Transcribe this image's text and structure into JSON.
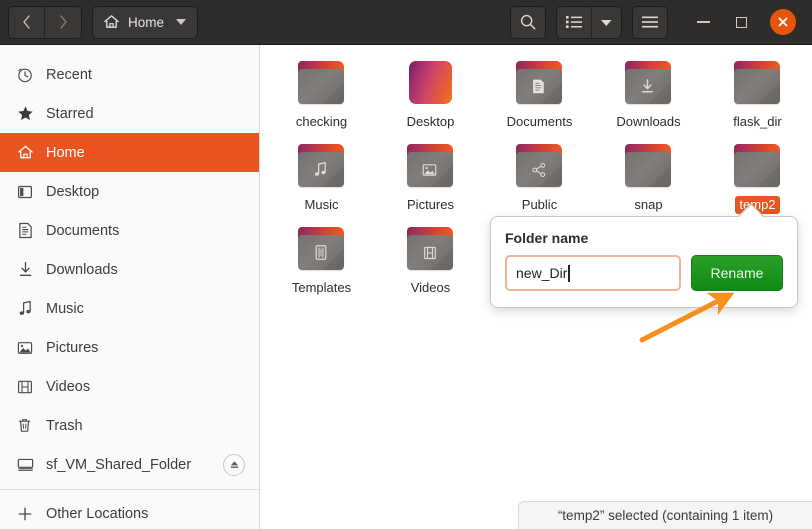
{
  "window": {
    "titlebar": {
      "back_label": "‹",
      "forward_label": "›",
      "path_label": "Home",
      "home_icon": "home-icon",
      "search_icon": "search-icon",
      "list_view_icon": "list-view-icon",
      "view_dropdown_icon": "chevron-down-icon",
      "menu_icon": "hamburger-menu-icon",
      "minimize_label": "–",
      "maximize_label": "□",
      "close_label": "✕"
    },
    "accent_color": "#e95420",
    "titlebar_color": "#2f2d2c"
  },
  "sidebar": {
    "items": [
      {
        "label": "Recent",
        "icon": "clock-icon",
        "active": false
      },
      {
        "label": "Starred",
        "icon": "star-icon",
        "active": false
      },
      {
        "label": "Home",
        "icon": "home-icon",
        "active": true
      },
      {
        "label": "Desktop",
        "icon": "desktop-icon",
        "active": false
      },
      {
        "label": "Documents",
        "icon": "document-icon",
        "active": false
      },
      {
        "label": "Downloads",
        "icon": "download-icon",
        "active": false
      },
      {
        "label": "Music",
        "icon": "music-note-icon",
        "active": false
      },
      {
        "label": "Pictures",
        "icon": "image-icon",
        "active": false
      },
      {
        "label": "Videos",
        "icon": "film-icon",
        "active": false
      },
      {
        "label": "Trash",
        "icon": "trash-icon",
        "active": false
      },
      {
        "label": "sf_VM_Shared_Folder",
        "icon": "drive-icon",
        "active": false,
        "eject": true
      }
    ],
    "other_locations": {
      "label": "Other Locations",
      "icon": "plus-icon"
    }
  },
  "files": [
    {
      "name": "checking",
      "type": "folder",
      "glyph": "",
      "selected": false
    },
    {
      "name": "Desktop",
      "type": "special",
      "glyph": "",
      "selected": false
    },
    {
      "name": "Documents",
      "type": "folder",
      "glyph": "document-icon",
      "selected": false
    },
    {
      "name": "Downloads",
      "type": "folder",
      "glyph": "download-icon",
      "selected": false
    },
    {
      "name": "flask_dir",
      "type": "folder",
      "glyph": "",
      "selected": false
    },
    {
      "name": "Music",
      "type": "folder",
      "glyph": "music-note-icon",
      "selected": false
    },
    {
      "name": "Pictures",
      "type": "folder",
      "glyph": "image-icon",
      "selected": false
    },
    {
      "name": "Public",
      "type": "folder",
      "glyph": "share-icon",
      "selected": false
    },
    {
      "name": "snap",
      "type": "folder",
      "glyph": "",
      "selected": false
    },
    {
      "name": "temp2",
      "type": "folder",
      "glyph": "",
      "selected": true
    },
    {
      "name": "Templates",
      "type": "folder",
      "glyph": "template-icon",
      "selected": false
    },
    {
      "name": "Videos",
      "type": "folder",
      "glyph": "film-icon",
      "selected": false
    }
  ],
  "rename_popover": {
    "label": "Folder name",
    "input_value": "new_Dir",
    "input_placeholder": "Folder name",
    "button_label": "Rename",
    "button_color": "#1a8f1a",
    "input_border_color": "#f0b49c"
  },
  "annotation": {
    "arrow_color": "#f7901e",
    "points_to": "rename-button"
  },
  "statusbar": {
    "text": "“temp2” selected  (containing 1 item)"
  }
}
